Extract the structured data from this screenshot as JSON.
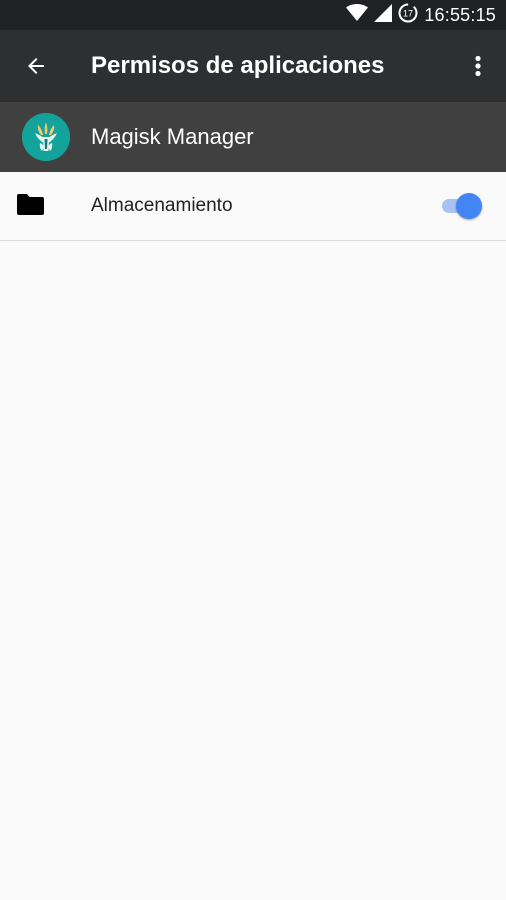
{
  "status_bar": {
    "time": "16:55:15",
    "badge_number": "17",
    "icons": [
      "wifi-icon",
      "signal-icon",
      "data-saver-icon"
    ]
  },
  "toolbar": {
    "title": "Permisos de aplicaciones",
    "back_icon": "arrow-back-icon",
    "overflow_icon": "more-vert-icon"
  },
  "app": {
    "name": "Magisk Manager",
    "icon": "magisk-logo-icon",
    "icon_color": "#13a39a"
  },
  "permissions": [
    {
      "label": "Almacenamiento",
      "icon": "folder-icon",
      "enabled": true
    }
  ],
  "colors": {
    "status_bar_bg": "#1f2124",
    "toolbar_bg": "#2e2f31",
    "app_header_bg": "#404040",
    "accent": "#4285f4",
    "background": "#fafafa"
  }
}
